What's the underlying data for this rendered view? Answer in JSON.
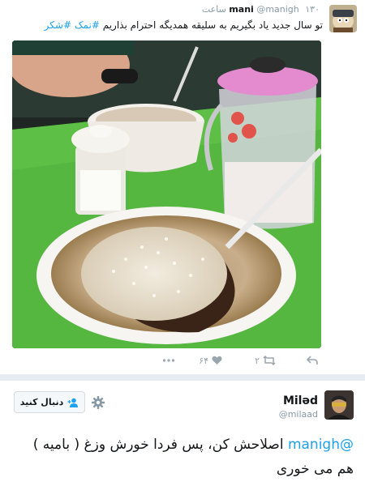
{
  "tweet": {
    "display_name": "mani",
    "handle": "@manigh",
    "time": "۱۳۰ ساعت",
    "text": "تو سال جدید یاد بگیریم به سلیقه همدیگه احترام بذاریم",
    "hashtags": "#نمک #شکر",
    "actions": {
      "retweet_count": "۲",
      "like_count": "۶۴"
    }
  },
  "reply": {
    "display_name": "Miləd",
    "handle": "@milaad",
    "follow_label": "دنبال کنید",
    "mention": "@manigh",
    "text": " اصلاحش کن، پس فردا خورش وزغ ( بامیه ) هم می خوری"
  },
  "icons": {
    "reply": "reply-icon",
    "retweet": "retweet-icon",
    "like": "heart-icon",
    "more": "more-icon",
    "settings": "gear-icon",
    "follow": "add-user-icon"
  },
  "colors": {
    "link": "#1da1f2",
    "muted": "#8899a6",
    "divider": "#e6ecf0"
  }
}
